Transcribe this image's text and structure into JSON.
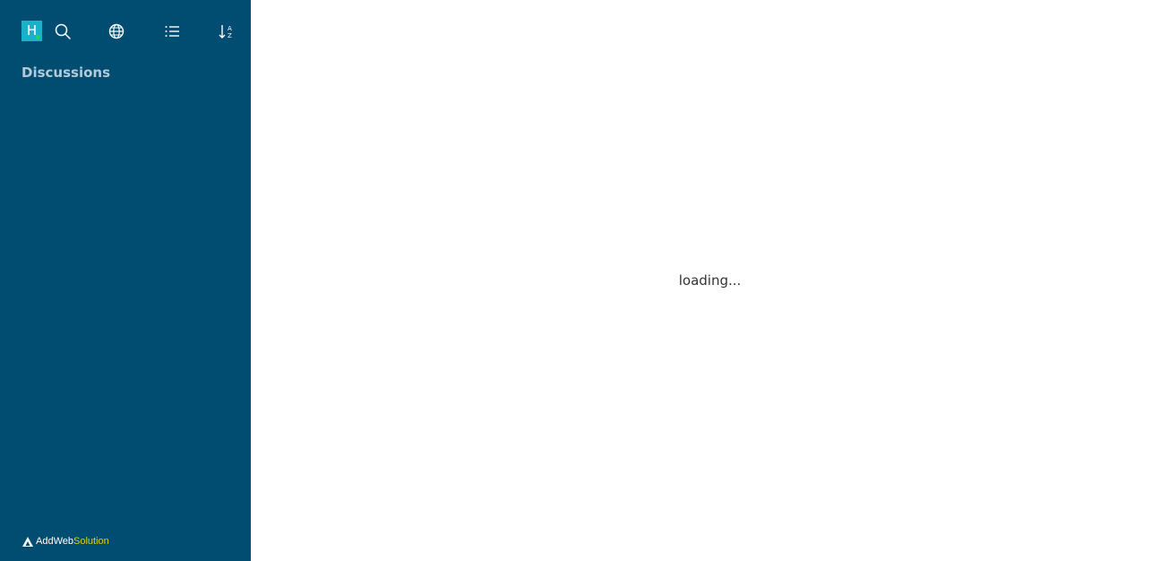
{
  "sidebar": {
    "avatar_letter": "H",
    "toolbar": [
      {
        "icon": "search-icon"
      },
      {
        "icon": "globe-icon"
      },
      {
        "icon": "list-icon"
      },
      {
        "icon": "sort-az-icon"
      }
    ],
    "section_title": "Discussions",
    "brand": {
      "part1": "AddWeb",
      "part2": "Solution"
    }
  },
  "main": {
    "loading_text": "loading..."
  },
  "colors": {
    "sidebar_bg": "#004d71",
    "avatar_bg": "#19b2c8",
    "presence": "#2ecc71",
    "brand_accent": "#d6d01e"
  }
}
